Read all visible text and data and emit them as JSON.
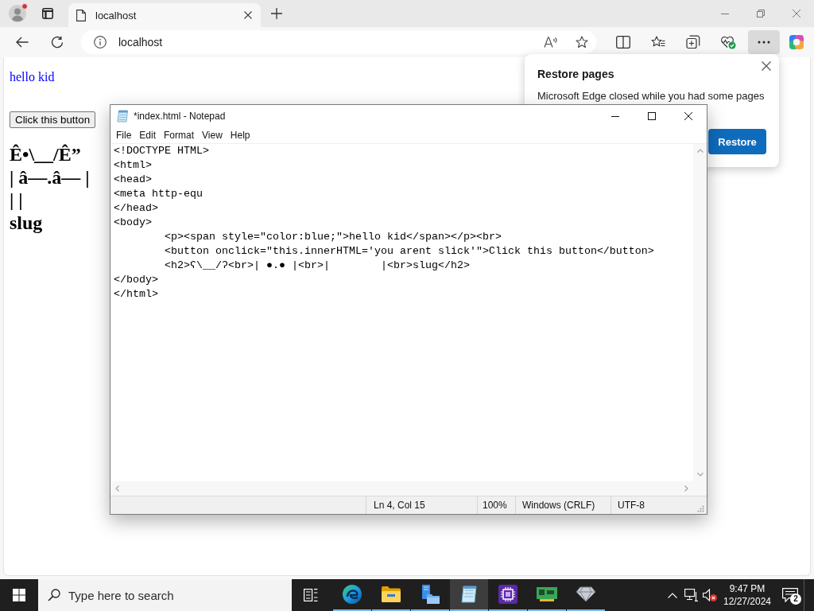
{
  "browser": {
    "profile_alert": true,
    "tabs": [
      {
        "title": "localhost",
        "selected": true
      }
    ],
    "address": "localhost",
    "more_menu_open": true,
    "page": {
      "greeting": "hello kid",
      "button": "Click this button",
      "heading_lines": [
        "Ê•\\__/Ê”",
        "| â—.â— |",
        "| |",
        "slug"
      ]
    },
    "restore_popup": {
      "title": "Restore pages",
      "message": "Microsoft Edge closed while you had some pages",
      "button": "Restore"
    }
  },
  "notepad": {
    "title": "*index.html - Notepad",
    "menu": [
      "File",
      "Edit",
      "Format",
      "View",
      "Help"
    ],
    "lines": [
      "<!DOCTYPE HTML>",
      "<html>",
      "<head>",
      "<meta http-equ",
      "</head>",
      "<body>",
      "\t<p><span style=\"color:blue;\">hello kid</span></p><br>",
      "\t<button onclick=\"this.innerHTML='you arent slick'\">Click this button</button>",
      "\t<h2>ʕ\\__/ʔ<br>| ●.● |<br>|        |<br>slug</h2>",
      "</body>",
      "</html>"
    ],
    "status": {
      "position": "Ln 4, Col 15",
      "zoom": "100%",
      "line_endings": "Windows (CRLF)",
      "encoding": "UTF-8"
    }
  },
  "taskbar": {
    "search": {
      "placeholder": "Type here to search"
    },
    "apps": [
      {
        "kind": "browser",
        "running": true,
        "selected": false
      },
      {
        "kind": "folder",
        "running": true,
        "selected": false
      },
      {
        "kind": "computer",
        "running": true,
        "selected": false
      },
      {
        "kind": "notepad",
        "running": true,
        "selected": true
      },
      {
        "kind": "chip",
        "running": true,
        "selected": false
      },
      {
        "kind": "board",
        "running": true,
        "selected": false
      },
      {
        "kind": "gem",
        "running": true,
        "selected": false
      }
    ],
    "volume_muted": true,
    "time": "9:47 PM",
    "date": "12/27/2024",
    "notification_count": "2"
  }
}
